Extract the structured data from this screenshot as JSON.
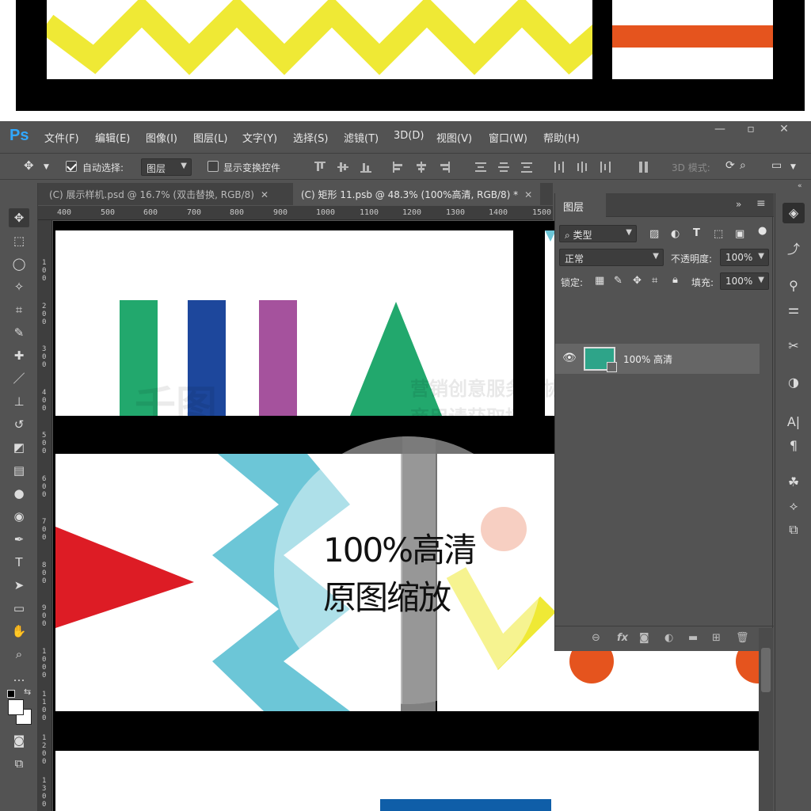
{
  "app": {
    "logo": "Ps",
    "window_buttons": [
      "—",
      "▫",
      "✕"
    ]
  },
  "menu": [
    "文件(F)",
    "编辑(E)",
    "图像(I)",
    "图层(L)",
    "文字(Y)",
    "选择(S)",
    "滤镜(T)",
    "3D(D)",
    "视图(V)",
    "窗口(W)",
    "帮助(H)"
  ],
  "options": {
    "auto_select_label": "自动选择:",
    "auto_select_checked": true,
    "auto_select_target": "图层",
    "show_transform_label": "显示变换控件",
    "show_transform_checked": false,
    "mode_3d_label": "3D 模式:"
  },
  "tabs": [
    {
      "label": "(C) 展示样机.psd @ 16.7% (双击替换, RGB/8)",
      "active": false
    },
    {
      "label": "(C) 矩形 11.psb @ 48.3% (100%高清, RGB/8) *",
      "active": true
    }
  ],
  "ruler_h": [
    "400",
    "500",
    "600",
    "700",
    "800",
    "900",
    "1000",
    "1100",
    "1200",
    "1300",
    "1400",
    "1500"
  ],
  "ruler_v": [
    "1 0 0",
    "2 0 0",
    "3 0 0",
    "4 0 0",
    "5 0 0",
    "6 0 0",
    "7 0 0",
    "8 0 0",
    "9 0 0",
    "1 0 0 0",
    "1 1 0 0",
    "1 2 0 0",
    "1 3 0 0"
  ],
  "layers_panel": {
    "title": "图层",
    "filter_label": "类型",
    "blend_mode": "正常",
    "opacity_label": "不透明度:",
    "opacity_value": "100%",
    "lock_label": "锁定:",
    "fill_label": "填充:",
    "fill_value": "100%",
    "layer_name": "100% 高清"
  },
  "canvas": {
    "watermark_logo": "千图",
    "watermark_line1": "营销创意服务与协作平台",
    "watermark_line2": "商用请获取授权",
    "overlay_line1": "100%高清",
    "overlay_line2": "原图缩放"
  },
  "colors": {
    "green": "#22a86d",
    "blue": "#1d479c",
    "purple": "#a5529d",
    "red": "#dd1c25",
    "cyan": "#6cc6d7",
    "yellow": "#efe935",
    "orange": "#e5541e",
    "salmon": "#f0a890",
    "layer_thumb": "#2ea489"
  }
}
